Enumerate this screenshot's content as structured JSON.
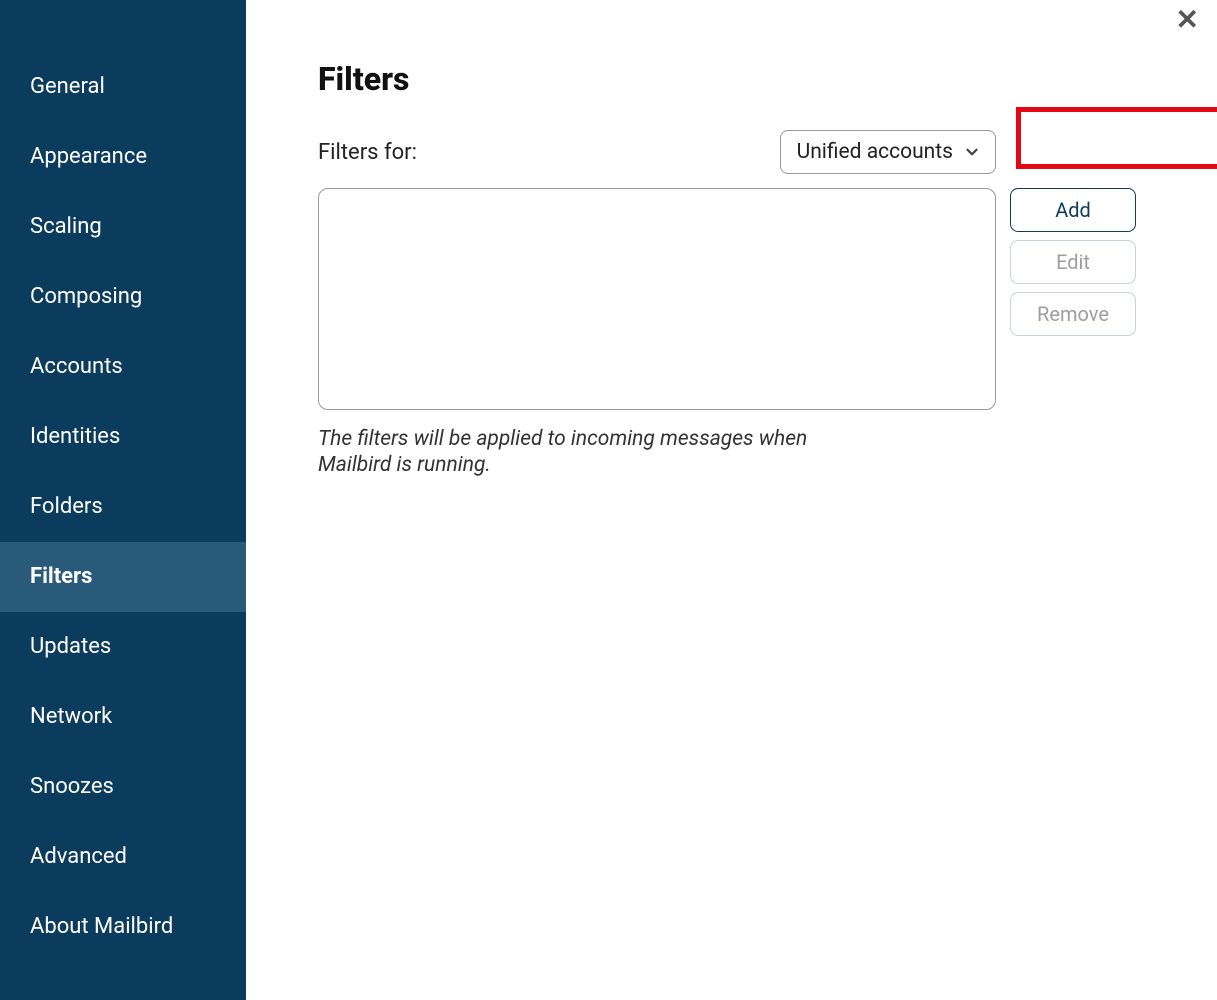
{
  "sidebar": {
    "items": [
      {
        "label": "General"
      },
      {
        "label": "Appearance"
      },
      {
        "label": "Scaling"
      },
      {
        "label": "Composing"
      },
      {
        "label": "Accounts"
      },
      {
        "label": "Identities"
      },
      {
        "label": "Folders"
      },
      {
        "label": "Filters",
        "active": true
      },
      {
        "label": "Updates"
      },
      {
        "label": "Network"
      },
      {
        "label": "Snoozes"
      },
      {
        "label": "Advanced"
      },
      {
        "label": "About Mailbird"
      }
    ]
  },
  "page": {
    "title": "Filters",
    "filters_for_label": "Filters for:",
    "selected_account": "Unified accounts",
    "hint": "The filters will be applied to incoming messages when Mailbird is running."
  },
  "buttons": {
    "add": "Add",
    "edit": "Edit",
    "remove": "Remove"
  },
  "colors": {
    "sidebar_bg": "#0b3c5d",
    "sidebar_active_bg": "#2a5a7a",
    "highlight_border": "#e30613",
    "primary_text": "#0b3c5d"
  },
  "callouts": {
    "highlight_dropdown": true,
    "highlight_add_button": true
  }
}
